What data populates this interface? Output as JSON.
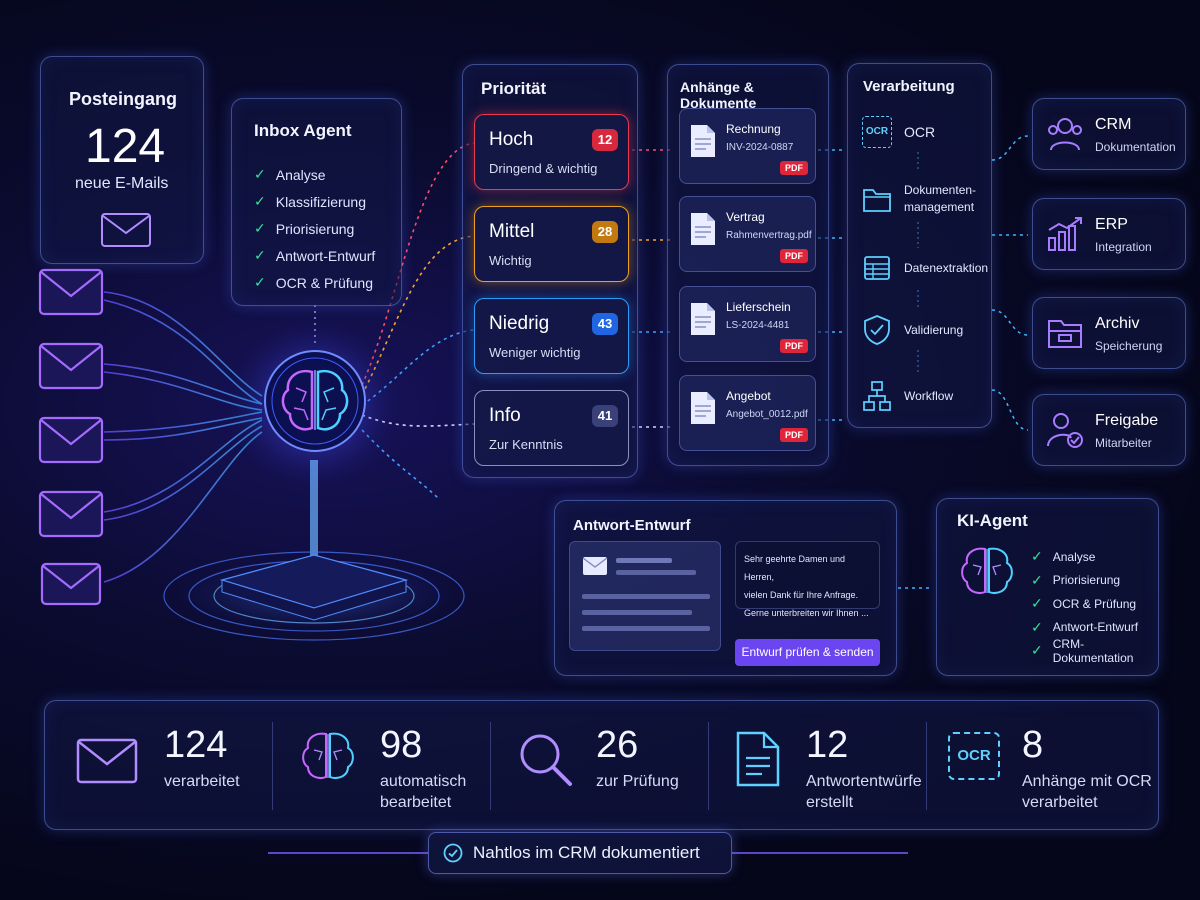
{
  "inbox": {
    "title": "Posteingang",
    "count": "124",
    "label": "neue E-Mails"
  },
  "agent": {
    "title": "Inbox Agent",
    "items": [
      "Analyse",
      "Klassifizierung",
      "Priorisierung",
      "Antwort-Entwurf",
      "OCR & Prüfung"
    ]
  },
  "priority": {
    "title": "Priorität",
    "items": [
      {
        "name": "Hoch",
        "desc": "Dringend & wichtig",
        "count": "12",
        "color": "#e83a4f"
      },
      {
        "name": "Mittel",
        "desc": "Wichtig",
        "count": "28",
        "color": "#f0a020"
      },
      {
        "name": "Niedrig",
        "desc": "Weniger wichtig",
        "count": "43",
        "color": "#2d7df6"
      },
      {
        "name": "Info",
        "desc": "Zur Kenntnis",
        "count": "41",
        "color": "#6a73a8"
      }
    ]
  },
  "attachments": {
    "title": "Anhänge & Dokumente",
    "items": [
      {
        "name": "Rechnung",
        "file": "INV-2024-0887",
        "badge": "PDF"
      },
      {
        "name": "Vertrag",
        "file": "Rahmenvertrag.pdf",
        "badge": "PDF"
      },
      {
        "name": "Lieferschein",
        "file": "LS-2024-4481",
        "badge": "PDF"
      },
      {
        "name": "Angebot",
        "file": "Angebot_0012.pdf",
        "badge": "PDF"
      }
    ]
  },
  "processing": {
    "title": "Verarbeitung",
    "ocr_icon_text": "OCR",
    "steps": [
      {
        "label": "OCR",
        "icon": "ocr-icon"
      },
      {
        "label1": "Dokumenten-",
        "label2": "management",
        "icon": "folder-icon"
      },
      {
        "label": "Datenextraktion",
        "icon": "table-icon"
      },
      {
        "label": "Validierung",
        "icon": "shield-check-icon"
      },
      {
        "label": "Workflow",
        "icon": "workflow-icon"
      }
    ]
  },
  "targets": [
    {
      "name": "CRM",
      "sub": "Dokumentation",
      "icon": "users-icon"
    },
    {
      "name": "ERP",
      "sub": "Integration",
      "icon": "bar-chart-icon"
    },
    {
      "name": "Archiv",
      "sub": "Speicherung",
      "icon": "archive-icon"
    },
    {
      "name": "Freigabe",
      "sub": "Mitarbeiter",
      "icon": "user-check-icon"
    }
  ],
  "reply": {
    "title": "Antwort-Entwurf",
    "line1": "Sehr geehrte Damen und Herren,",
    "line2": "vielen Dank für Ihre Anfrage.",
    "line3": "Gerne unterbreiten wir Ihnen ...",
    "button": "Entwurf prüfen & senden"
  },
  "ki_agent": {
    "title": "KI-Agent",
    "items": [
      "Analyse",
      "Priorisierung",
      "OCR & Prüfung",
      "Antwort-Entwurf",
      "CRM-Dokumentation"
    ]
  },
  "stats": [
    {
      "value": "124",
      "label1": "verarbeitet",
      "label2": "",
      "icon": "mail-icon"
    },
    {
      "value": "98",
      "label1": "automatisch",
      "label2": "bearbeitet",
      "icon": "brain-icon"
    },
    {
      "value": "26",
      "label1": "zur Prüfung",
      "label2": "",
      "icon": "search-icon"
    },
    {
      "value": "12",
      "label1": "Antwortentwürfe",
      "label2": "erstellt",
      "icon": "document-icon"
    },
    {
      "value": "8",
      "label1": "Anhänge mit OCR",
      "label2": "verarbeitet",
      "icon": "ocr-icon"
    }
  ],
  "footer": {
    "label": "Nahtlos im CRM dokumentiert"
  },
  "colors": {
    "accent": "#7b5cff",
    "check": "#37e39a",
    "pdf": "#e0243a"
  }
}
